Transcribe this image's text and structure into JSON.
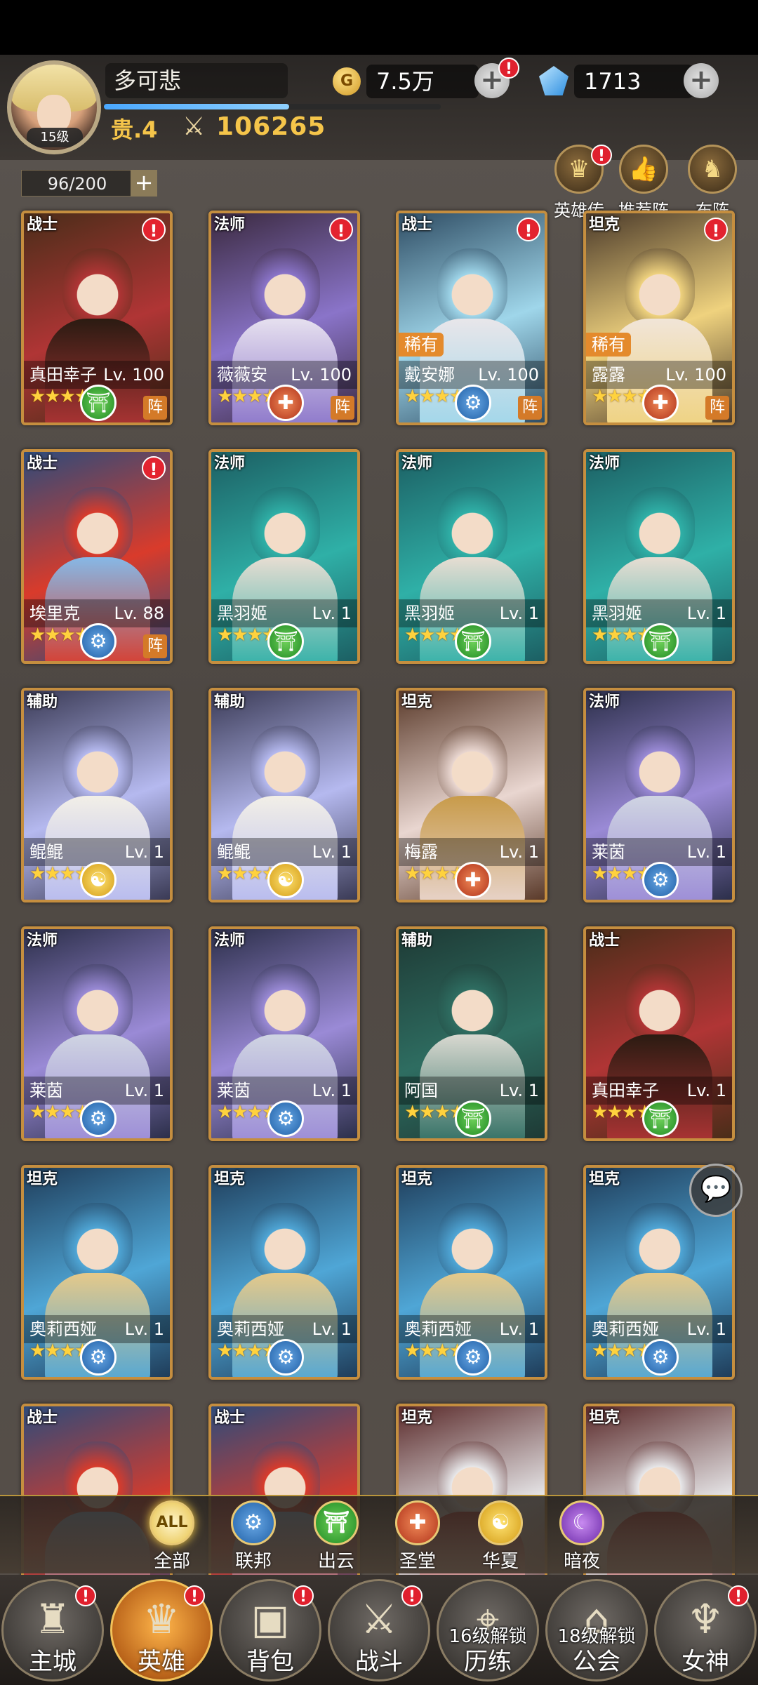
{
  "player": {
    "name": "多可悲",
    "level": "15级",
    "rank": "贵.4",
    "power": "106265",
    "gold": "7.5万",
    "gems": "1713",
    "exp_fraction": 0.55
  },
  "capacity": "96/200",
  "func_buttons": [
    {
      "label": "英雄传",
      "icon": "crown-icon"
    },
    {
      "label": "推荐阵",
      "icon": "thumbs-up-icon"
    },
    {
      "label": "布阵",
      "icon": "horse-icon"
    }
  ],
  "heroes": [
    {
      "name": "真田幸子",
      "level": "Lv. 100",
      "role": "战士",
      "stars": 5,
      "faction": "chuyun",
      "alert": true,
      "zhen": true,
      "rare": "",
      "palette": [
        "#4a2d19",
        "#b03535",
        "#2b1b12"
      ]
    },
    {
      "name": "薇薇安",
      "level": "Lv. 100",
      "role": "法师",
      "stars": 5,
      "faction": "holy",
      "alert": true,
      "zhen": true,
      "rare": "",
      "palette": [
        "#3b2a40",
        "#8a74c9",
        "#e6e0ef"
      ]
    },
    {
      "name": "戴安娜",
      "level": "Lv. 100",
      "role": "战士",
      "stars": 5,
      "faction": "federation",
      "alert": true,
      "zhen": true,
      "rare": "稀有",
      "palette": [
        "#2f4d64",
        "#9fd6ea",
        "#e8e6ea"
      ]
    },
    {
      "name": "露露",
      "level": "Lv. 100",
      "role": "坦克",
      "stars": 5,
      "faction": "holy",
      "alert": true,
      "zhen": true,
      "rare": "稀有",
      "palette": [
        "#4b3a2a",
        "#efd27e",
        "#f1e5d8"
      ]
    },
    {
      "name": "埃里克",
      "level": "Lv. 88",
      "role": "战士",
      "stars": 5,
      "faction": "federation",
      "alert": true,
      "zhen": true,
      "rare": "",
      "palette": [
        "#2e4b7a",
        "#d93b2b",
        "#86b8e6"
      ]
    },
    {
      "name": "黑羽姬",
      "level": "Lv. 1",
      "role": "法师",
      "stars": 5,
      "faction": "chuyun",
      "alert": false,
      "zhen": false,
      "rare": "",
      "palette": [
        "#1c5f63",
        "#2fb0a7",
        "#e7ddd2"
      ]
    },
    {
      "name": "黑羽姬",
      "level": "Lv. 1",
      "role": "法师",
      "stars": 5,
      "faction": "chuyun",
      "alert": false,
      "zhen": false,
      "rare": "",
      "palette": [
        "#1c5f63",
        "#2fb0a7",
        "#e7ddd2"
      ]
    },
    {
      "name": "黑羽姬",
      "level": "Lv. 1",
      "role": "法师",
      "stars": 5,
      "faction": "chuyun",
      "alert": false,
      "zhen": false,
      "rare": "",
      "palette": [
        "#1c5f63",
        "#2fb0a7",
        "#e7ddd2"
      ]
    },
    {
      "name": "鲲鲲",
      "level": "Lv. 1",
      "role": "辅助",
      "stars": 5,
      "faction": "huaxia",
      "alert": false,
      "zhen": false,
      "rare": "",
      "palette": [
        "#3a3a55",
        "#b5b9ef",
        "#f2efe7"
      ]
    },
    {
      "name": "鲲鲲",
      "level": "Lv. 1",
      "role": "辅助",
      "stars": 5,
      "faction": "huaxia",
      "alert": false,
      "zhen": false,
      "rare": "",
      "palette": [
        "#3a3a55",
        "#b5b9ef",
        "#f2efe7"
      ]
    },
    {
      "name": "梅露",
      "level": "Lv. 1",
      "role": "坦克",
      "stars": 5,
      "faction": "holy",
      "alert": false,
      "zhen": false,
      "rare": "",
      "palette": [
        "#5a3a2a",
        "#e9d6d0",
        "#c89b4a"
      ]
    },
    {
      "name": "莱茵",
      "level": "Lv. 1",
      "role": "法师",
      "stars": 5,
      "faction": "federation",
      "alert": false,
      "zhen": false,
      "rare": "",
      "palette": [
        "#2c2f4a",
        "#9a8ad6",
        "#cfd4e2"
      ]
    },
    {
      "name": "莱茵",
      "level": "Lv. 1",
      "role": "法师",
      "stars": 5,
      "faction": "federation",
      "alert": false,
      "zhen": false,
      "rare": "",
      "palette": [
        "#2c2f4a",
        "#9a8ad6",
        "#cfd4e2"
      ]
    },
    {
      "name": "莱茵",
      "level": "Lv. 1",
      "role": "法师",
      "stars": 5,
      "faction": "federation",
      "alert": false,
      "zhen": false,
      "rare": "",
      "palette": [
        "#2c2f4a",
        "#9a8ad6",
        "#cfd4e2"
      ]
    },
    {
      "name": "阿国",
      "level": "Lv. 1",
      "role": "辅助",
      "stars": 5,
      "faction": "chuyun",
      "alert": false,
      "zhen": false,
      "rare": "",
      "palette": [
        "#1e3a35",
        "#2e6d61",
        "#d8d8d0"
      ]
    },
    {
      "name": "真田幸子",
      "level": "Lv. 1",
      "role": "战士",
      "stars": 5,
      "faction": "chuyun",
      "alert": false,
      "zhen": false,
      "rare": "",
      "palette": [
        "#4a2d19",
        "#b03535",
        "#2b1b12"
      ]
    },
    {
      "name": "奥莉西娅",
      "level": "Lv. 1",
      "role": "坦克",
      "stars": 5,
      "faction": "federation",
      "alert": false,
      "zhen": false,
      "rare": "",
      "palette": [
        "#1f3d5a",
        "#4fa6d6",
        "#e5c98a"
      ]
    },
    {
      "name": "奥莉西娅",
      "level": "Lv. 1",
      "role": "坦克",
      "stars": 5,
      "faction": "federation",
      "alert": false,
      "zhen": false,
      "rare": "",
      "palette": [
        "#1f3d5a",
        "#4fa6d6",
        "#e5c98a"
      ]
    },
    {
      "name": "奥莉西娅",
      "level": "Lv. 1",
      "role": "坦克",
      "stars": 5,
      "faction": "federation",
      "alert": false,
      "zhen": false,
      "rare": "",
      "palette": [
        "#1f3d5a",
        "#4fa6d6",
        "#e5c98a"
      ]
    },
    {
      "name": "奥莉西娅",
      "level": "Lv. 1",
      "role": "坦克",
      "stars": 5,
      "faction": "federation",
      "alert": false,
      "zhen": false,
      "rare": "",
      "palette": [
        "#1f3d5a",
        "#4fa6d6",
        "#e5c98a"
      ]
    },
    {
      "name": "",
      "level": "",
      "role": "战士",
      "stars": 0,
      "faction": "",
      "alert": false,
      "zhen": false,
      "rare": "",
      "palette": [
        "#2e4b7a",
        "#d93b2b",
        "#86b8e6"
      ]
    },
    {
      "name": "",
      "level": "",
      "role": "战士",
      "stars": 0,
      "faction": "",
      "alert": false,
      "zhen": false,
      "rare": "",
      "palette": [
        "#2e4b7a",
        "#d93b2b",
        "#86b8e6"
      ]
    },
    {
      "name": "",
      "level": "",
      "role": "坦克",
      "stars": 0,
      "faction": "",
      "alert": false,
      "zhen": false,
      "rare": "",
      "palette": [
        "#5a2a2a",
        "#e8e8ea",
        "#b22a2a"
      ]
    },
    {
      "name": "",
      "level": "",
      "role": "坦克",
      "stars": 0,
      "faction": "",
      "alert": false,
      "zhen": false,
      "rare": "",
      "palette": [
        "#5a2a2a",
        "#e8e8ea",
        "#b22a2a"
      ]
    }
  ],
  "zhen_label": "阵",
  "filters": [
    {
      "label": "全部",
      "icon_text": "ALL",
      "key": "all",
      "active": true
    },
    {
      "label": "联邦",
      "icon_text": "⚙",
      "key": "federation",
      "active": false
    },
    {
      "label": "出云",
      "icon_text": "⛩",
      "key": "chuyun",
      "active": false
    },
    {
      "label": "圣堂",
      "icon_text": "✚",
      "key": "holy",
      "active": false
    },
    {
      "label": "华夏",
      "icon_text": "☯",
      "key": "huaxia",
      "active": false
    },
    {
      "label": "暗夜",
      "icon_text": "☾",
      "key": "night",
      "active": false
    }
  ],
  "nav": [
    {
      "label": "主城",
      "icon": "castle-icon",
      "glyph": "♜",
      "badge": true,
      "active": false,
      "lock": ""
    },
    {
      "label": "英雄",
      "icon": "hero-icon",
      "glyph": "♛",
      "badge": true,
      "active": true,
      "lock": ""
    },
    {
      "label": "背包",
      "icon": "backpack-icon",
      "glyph": "▣",
      "badge": true,
      "active": false,
      "lock": ""
    },
    {
      "label": "战斗",
      "icon": "swords-icon",
      "glyph": "⚔",
      "badge": true,
      "active": false,
      "lock": ""
    },
    {
      "label": "历练",
      "icon": "map-pin-icon",
      "glyph": "⌖",
      "badge": false,
      "active": false,
      "lock": "16级解锁"
    },
    {
      "label": "公会",
      "icon": "guild-icon",
      "glyph": "⌂",
      "badge": false,
      "active": false,
      "lock": "18级解锁"
    },
    {
      "label": "女神",
      "icon": "goddess-icon",
      "glyph": "♆",
      "badge": true,
      "active": false,
      "lock": ""
    }
  ]
}
